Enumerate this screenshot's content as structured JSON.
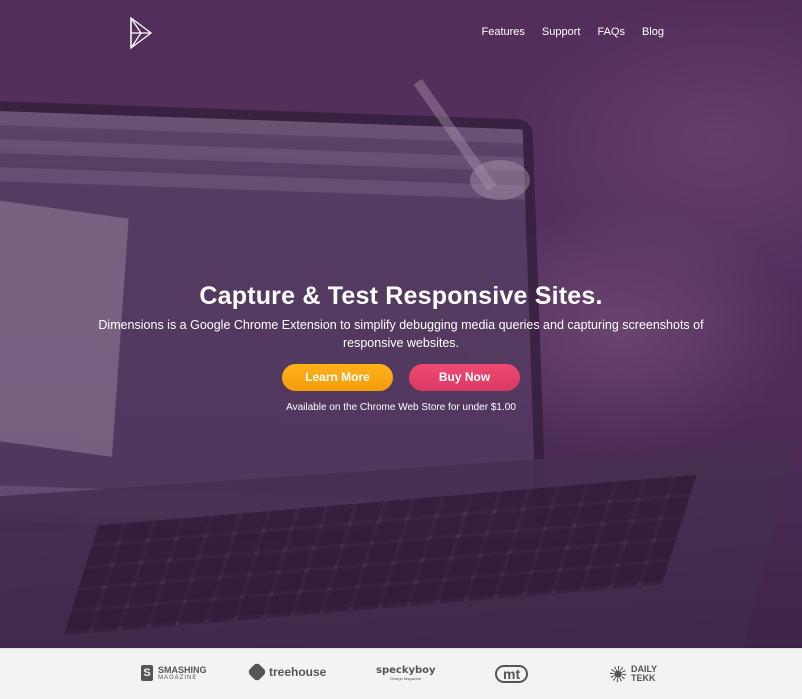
{
  "nav": {
    "items": [
      "Features",
      "Support",
      "FAQs",
      "Blog"
    ]
  },
  "hero": {
    "headline": "Capture & Test Responsive Sites.",
    "subtitle": "Dimensions is a Google Chrome Extension to simplify debugging media queries and capturing screenshots of responsive websites.",
    "learn_more_label": "Learn More",
    "buy_now_label": "Buy Now",
    "availability": "Available on the Chrome Web Store for under $1.00"
  },
  "partners": {
    "smashing": {
      "line1": "SMASHING",
      "line2": "MAGAZINE",
      "mark": "S"
    },
    "treehouse": {
      "name": "treehouse"
    },
    "speckyboy": {
      "name": "speckyboy",
      "tag": "Design Magazine"
    },
    "mt": {
      "name": "mt"
    },
    "dailytekk": {
      "line1": "DAILY",
      "line2": "TEKK"
    }
  },
  "colors": {
    "learn_more": "#f7a313",
    "buy_now": "#e2416b",
    "overlay": "#5a3560"
  }
}
